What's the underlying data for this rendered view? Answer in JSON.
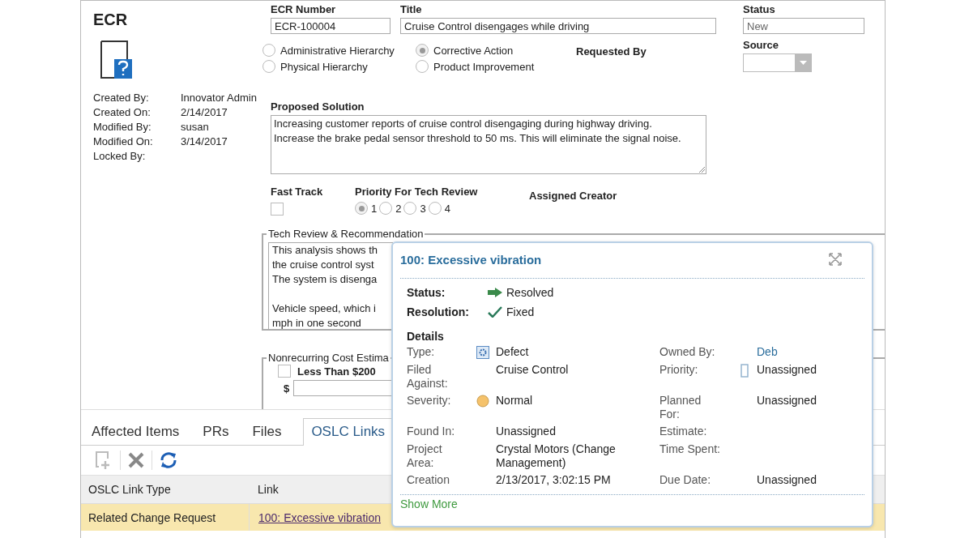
{
  "header": {
    "title": "ECR"
  },
  "meta": [
    {
      "label": "Created By:",
      "value": "Innovator Admin"
    },
    {
      "label": "Created On:",
      "value": "2/14/2017"
    },
    {
      "label": "Modified By:",
      "value": "susan"
    },
    {
      "label": "Modified On:",
      "value": "3/14/2017"
    },
    {
      "label": "Locked By:"
    }
  ],
  "ecr_number": {
    "label": "ECR Number",
    "value": "ECR-100004"
  },
  "title_field": {
    "label": "Title",
    "value": "Cruise Control disengages while driving"
  },
  "status_field": {
    "label": "Status",
    "value": "New"
  },
  "classification": [
    [
      {
        "label": "Administrative Hierarchy",
        "selected": false
      },
      {
        "label": "Physical Hierarchy",
        "selected": false
      }
    ],
    [
      {
        "label": "Corrective Action",
        "selected": true
      },
      {
        "label": "Product Improvement",
        "selected": false
      }
    ]
  ],
  "requested_by": {
    "label": "Requested By"
  },
  "source": {
    "label": "Source"
  },
  "proposed_solution": {
    "label": "Proposed Solution",
    "lines": [
      "Increasing customer reports of cruise control disengaging during highway driving.",
      "Increase the brake pedal sensor threshold to 50 ms. This will eliminate the signal noise."
    ]
  },
  "fast_track": {
    "label": "Fast Track",
    "checked": false
  },
  "priority": {
    "label": "Priority For Tech Review",
    "options": [
      {
        "label": "1",
        "selected": true
      },
      {
        "label": "2",
        "selected": false
      },
      {
        "label": "3",
        "selected": false
      },
      {
        "label": "4",
        "selected": false
      }
    ]
  },
  "assigned_creator": {
    "label": "Assigned Creator"
  },
  "tech_review": {
    "legend": "Tech Review & Recommendation",
    "paragraphs": [
      [
        "This analysis shows th",
        "the cruise control syst",
        "The system is disenga"
      ],
      [
        "Vehicle speed, which i",
        "mph in one second"
      ]
    ]
  },
  "cost_estimate": {
    "legend": "Nonrecurring Cost Estima",
    "less_than": {
      "label": "Less Than $200",
      "checked": false
    },
    "currency": "$"
  },
  "tabs": [
    {
      "label": "Affected Items",
      "selected": false
    },
    {
      "label": "PRs",
      "selected": false
    },
    {
      "label": "Files",
      "selected": false
    },
    {
      "label": "OSLC Links",
      "selected": true
    }
  ],
  "table": {
    "columns": [
      "OSLC Link Type",
      "Link"
    ],
    "rows": [
      {
        "cells": [
          "Related Change Request",
          "100: Excessive vibration"
        ],
        "selected": true
      }
    ]
  },
  "popover": {
    "title": "100: Excessive vibration",
    "summary": [
      {
        "label": "Status:",
        "value": "Resolved",
        "kind": "arrow"
      },
      {
        "label": "Resolution:",
        "value": "Fixed",
        "kind": "check"
      }
    ],
    "details_heading": "Details",
    "details": [
      {
        "left": {
          "label": "Type:",
          "value": "Defect",
          "kind": "defect"
        },
        "right": {
          "label": "Owned By:",
          "value": "Deb",
          "kind": "link"
        }
      },
      {
        "left": {
          "label": "Filed Against:",
          "value": "Cruise Control",
          "kind": "plain"
        },
        "right": {
          "label": "Priority:",
          "value": "Unassigned",
          "kind": "priority"
        }
      },
      {
        "left": {
          "label": "Severity:",
          "value": "Normal",
          "kind": "severity"
        },
        "right": {
          "label": "Planned For:",
          "value": "Unassigned",
          "kind": "plain"
        }
      },
      {
        "left": {
          "label": "Found In:",
          "value": "Unassigned",
          "kind": "plain"
        },
        "right": {
          "label": "Estimate:",
          "kind": "plain"
        }
      },
      {
        "left": {
          "label": "Project Area:",
          "value": "Crystal Motors (Change Management)",
          "kind": "plain"
        },
        "right": {
          "label": "Time Spent:",
          "kind": "plain"
        }
      },
      {
        "left": {
          "label": "Creation",
          "value": "2/13/2017, 3:02:15 PM",
          "kind": "plain"
        },
        "right": {
          "label": "Due Date:",
          "value": "Unassigned",
          "kind": "plain"
        }
      }
    ],
    "show_more": "Show More"
  }
}
